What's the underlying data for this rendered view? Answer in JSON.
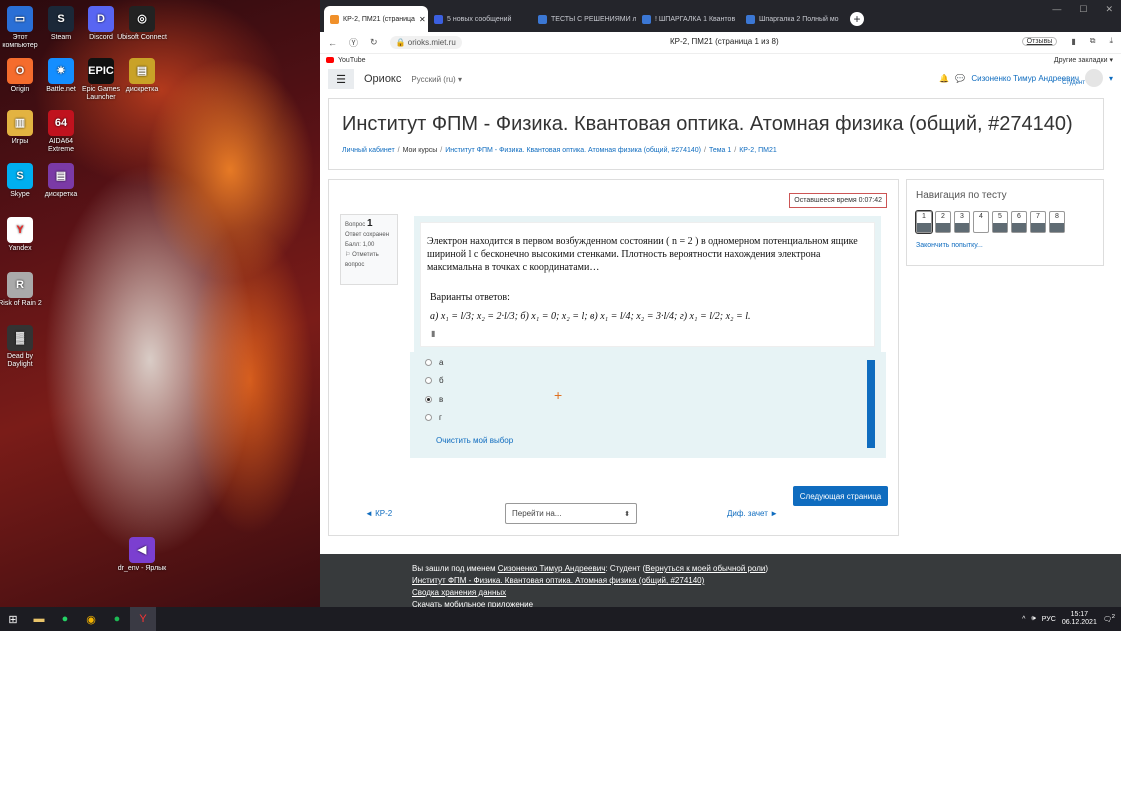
{
  "desktop": {
    "icons": [
      {
        "label": "Этот компьютер",
        "icon": "computer-icon",
        "color": "#2a6fd6",
        "glyph": "▭"
      },
      {
        "label": "Steam",
        "icon": "steam-icon",
        "color": "#1b2838",
        "glyph": "S"
      },
      {
        "label": "Discord",
        "icon": "discord-icon",
        "color": "#5865f2",
        "glyph": "D"
      },
      {
        "label": "Ubisoft Connect",
        "icon": "ubisoft-icon",
        "color": "#222",
        "glyph": "◎"
      },
      {
        "label": "Origin",
        "icon": "origin-icon",
        "color": "#f56c2d",
        "glyph": "O"
      },
      {
        "label": "Battle.net",
        "icon": "battlenet-icon",
        "color": "#148eff",
        "glyph": "✷"
      },
      {
        "label": "Epic Games Launcher",
        "icon": "epic-icon",
        "color": "#111",
        "glyph": "EPIC"
      },
      {
        "label": "дискретка",
        "icon": "winrar-icon",
        "color": "#c9a227",
        "glyph": "▤"
      },
      {
        "label": "Игры",
        "icon": "games-folder-icon",
        "color": "#e3b341",
        "glyph": "▥"
      },
      {
        "label": "AIDA64 Extreme",
        "icon": "aida64-icon",
        "color": "#c0121e",
        "glyph": "64"
      },
      {
        "label": "Skype",
        "icon": "skype-icon",
        "color": "#00aff0",
        "glyph": "S"
      },
      {
        "label": "дискретка",
        "icon": "winrar-icon",
        "color": "#7b3aa6",
        "glyph": "▤"
      },
      {
        "label": "Yandex",
        "icon": "yandex-icon",
        "color": "#fff",
        "glyph": "Y"
      },
      {
        "label": "Risk of Rain 2",
        "icon": "riskofrain-icon",
        "color": "#aaa",
        "glyph": "R"
      },
      {
        "label": "Dead by Daylight",
        "icon": "dbd-icon",
        "color": "#333",
        "glyph": "▓"
      },
      {
        "label": "dr_env - Ярлык",
        "icon": "visualstudio-icon",
        "color": "#7b3fd0",
        "glyph": "◀"
      }
    ]
  },
  "browser": {
    "tabs": [
      {
        "label": "КР-2, ПМ21 (страница",
        "active": true,
        "color": "#f0902a"
      },
      {
        "label": "5 новых сообщений",
        "active": false,
        "color": "#3b5fe0"
      },
      {
        "label": "ТЕСТЫ С РЕШЕНИЯМИ л",
        "active": false,
        "color": "#3b77d4"
      },
      {
        "label": "! ШПАРГАЛКА 1 Квантов",
        "active": false,
        "color": "#3b77d4"
      },
      {
        "label": "Шпаргалка 2 Полный мо",
        "active": false,
        "color": "#3b77d4"
      }
    ],
    "url": "orioks.miet.ru",
    "page_title": "КР-2, ПМ21 (страница 1 из 8)",
    "reviews_label": "Отзывы",
    "bookmarks": {
      "youtube": "YouTube",
      "other": "Другие закладки"
    }
  },
  "site": {
    "brand": "Ориокс",
    "lang": "Русский (ru)",
    "user_name": "Сизоненко Тимур Андреевич",
    "user_role": "Студент"
  },
  "course": {
    "title": "Институт ФПМ - Физика. Квантовая оптика. Атомная физика (общий, #274140)",
    "breadcrumb": [
      "Личный кабинет",
      "Мои курсы",
      "Институт ФПМ - Физика. Квантовая оптика. Атомная физика (общий, #274140)",
      "Тема 1",
      "КР-2, ПМ21"
    ]
  },
  "quiz": {
    "timer": "Оставшееся время 0:07:42",
    "question_label": "Вопрос",
    "question_number": "1",
    "status": "Ответ сохранен",
    "score": "Балл: 1,00",
    "flag": "Отметить вопрос",
    "question_text": "Электрон находится в первом возбужденном состоянии ( n = 2 ) в одномерном потенциальном ящике шириной l с бесконечно высокими стенками. Плотность вероятности нахождения электрона максимальна в точках с координатами…",
    "variants_title": "Варианты ответов:",
    "variants_line": "а) x₁ = l/3; x₂ = 2·l/3;   б) x₁ = 0; x₂ = l;   в) x₁ = l/4; x₂ = 3·l/4;   г) x₁ = l/2; x₂ = l.",
    "answers": [
      {
        "label": "а",
        "selected": false
      },
      {
        "label": "б",
        "selected": false
      },
      {
        "label": "в",
        "selected": true
      },
      {
        "label": "г",
        "selected": false
      }
    ],
    "clear": "Очистить мой выбор",
    "next_button": "Следующая страница",
    "prev_link": "◄ КР-2",
    "jump_placeholder": "Перейти на...",
    "next_link": "Диф. зачет ►"
  },
  "nav": {
    "title": "Навигация по тесту",
    "pages": [
      {
        "n": "1",
        "answered": true,
        "current": true
      },
      {
        "n": "2",
        "answered": true
      },
      {
        "n": "3",
        "answered": true
      },
      {
        "n": "4",
        "answered": false
      },
      {
        "n": "5",
        "answered": true
      },
      {
        "n": "6",
        "answered": true
      },
      {
        "n": "7",
        "answered": true
      },
      {
        "n": "8",
        "answered": true
      }
    ],
    "finish": "Закончить попытку..."
  },
  "footer": {
    "logged_as_prefix": "Вы зашли под именем",
    "user_link": "Сизоненко Тимур Андреевич",
    "role_suffix": ": Студент (",
    "return_link": "Вернуться к моей обычной роли",
    "role_close": ")",
    "course_link": "Институт ФПМ - Физика. Квантовая оптика. Атомная физика (общий, #274140)",
    "retention_link": "Сводка хранения данных",
    "mobile_link": "Скачать мобильное приложение"
  },
  "taskbar": {
    "lang": "РУС",
    "time": "15:17",
    "date": "06.12.2021",
    "notifications": "2"
  }
}
